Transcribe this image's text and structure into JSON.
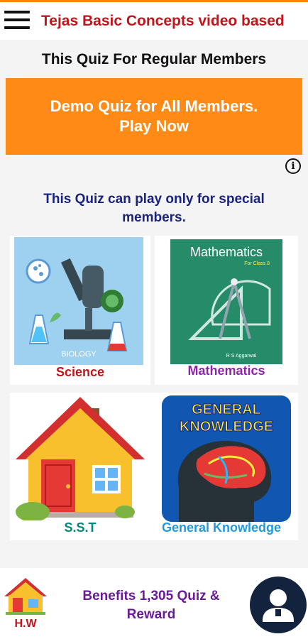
{
  "app_title": "Tejas Basic Concepts video based",
  "regular_title": "This Quiz For Regular Members",
  "demo_banner": {
    "line1": "Demo Quiz for All Members.",
    "line2": "Play Now"
  },
  "info_glyph": "i",
  "special_note": "This Quiz can play only for special members.",
  "subjects": [
    {
      "label": "Science",
      "color": "#c0151b"
    },
    {
      "label": "Mathematics",
      "color": "#8e24aa",
      "cover_title": "Mathematics",
      "cover_subtitle": "For Class 8",
      "cover_author": "R S Aggarwal"
    },
    {
      "label": "S.S.T",
      "color": "#00897b"
    },
    {
      "label": "General Knowledge",
      "color": "#1e9be0",
      "cover_line1": "GENERAL",
      "cover_line2": "KNOWLEDGE"
    }
  ],
  "science_cover_caption": "BIOLOGY",
  "footer": {
    "hw_label": "H.W",
    "benefits_label": "Benefits 1,305 Quiz & Reward"
  },
  "colors": {
    "accent": "#ff8a15",
    "title_red": "#c0151b",
    "navy": "#1a237e"
  }
}
